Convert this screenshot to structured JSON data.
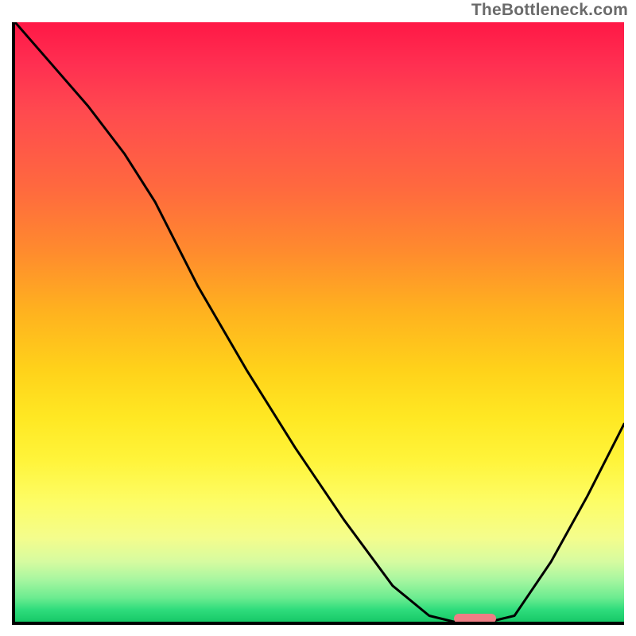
{
  "watermark": "TheBottleneck.com",
  "colors": {
    "axis": "#000000",
    "curve": "#000000",
    "marker": "#ef7e85",
    "watermark": "#6b6b6b"
  },
  "chart_data": {
    "type": "line",
    "title": "",
    "xlabel": "",
    "ylabel": "",
    "xlim": [
      0,
      100
    ],
    "ylim": [
      0,
      100
    ],
    "x": [
      0,
      6,
      12,
      18,
      23,
      30,
      38,
      46,
      54,
      62,
      68,
      72,
      75,
      78,
      82,
      88,
      94,
      100
    ],
    "y": [
      100,
      93,
      86,
      78,
      70,
      56,
      42,
      29,
      17,
      6,
      1,
      0,
      0,
      0,
      1,
      10,
      21,
      33
    ],
    "marker": {
      "x_start": 72,
      "x_end": 79,
      "y": 0.5
    },
    "note": "x and y are 0–100; y=100 is the top of the plot, y=0 is the baseline."
  }
}
